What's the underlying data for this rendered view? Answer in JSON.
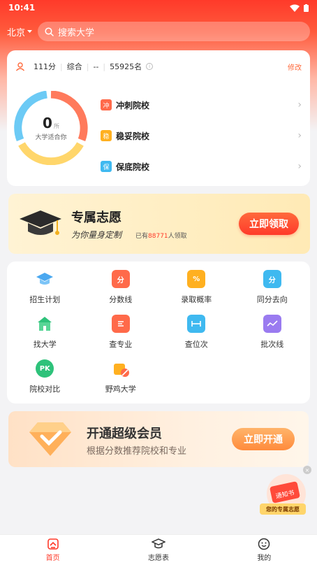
{
  "status_bar": {
    "time": "10:41"
  },
  "header": {
    "city": "北京",
    "search_placeholder": "搜索大学"
  },
  "score": {
    "points": "111分",
    "subject": "综合",
    "dash": "--",
    "rank": "55925名",
    "edit_label": "修改"
  },
  "donut": {
    "count": "0",
    "unit": "所",
    "caption": "大学适合你",
    "colors": [
      "#ff7a5c",
      "#ffd66b",
      "#6ccaf5"
    ]
  },
  "categories": [
    {
      "badge": "冲",
      "label": "冲刺院校",
      "color": "#ff6a4a"
    },
    {
      "badge": "稳",
      "label": "稳妥院校",
      "color": "#ffb020"
    },
    {
      "badge": "保",
      "label": "保底院校",
      "color": "#3fb9f0"
    }
  ],
  "exclusive_banner": {
    "title": "专属志愿",
    "slogan": "为你量身定制",
    "count_prefix": "已有",
    "count_value": "88771",
    "count_suffix": "人领取",
    "cta": "立即领取"
  },
  "tools": [
    {
      "label": "招生计划",
      "icon": "graduation-cap-icon",
      "color": "#4aa8f0"
    },
    {
      "label": "分数线",
      "icon": "score-book-icon",
      "color": "#ff6a4a"
    },
    {
      "label": "录取概率",
      "icon": "percent-icon",
      "color": "#ffb020"
    },
    {
      "label": "同分去向",
      "icon": "same-score-icon",
      "color": "#3fb9f0"
    },
    {
      "label": "找大学",
      "icon": "university-icon",
      "color": "#2ec27a"
    },
    {
      "label": "查专业",
      "icon": "major-book-icon",
      "color": "#ff6a4a"
    },
    {
      "label": "查位次",
      "icon": "rank-icon",
      "color": "#3fb9f0"
    },
    {
      "label": "批次线",
      "icon": "batch-line-icon",
      "color": "#9a7bf0"
    },
    {
      "label": "院校对比",
      "icon": "pk-icon",
      "color": "#2ec27a"
    },
    {
      "label": "野鸡大学",
      "icon": "fake-university-icon",
      "color": "#ff8b3c"
    }
  ],
  "vip_banner": {
    "title": "开通超级会员",
    "subtitle": "根据分数推荐院校和专业",
    "cta": "立即开通"
  },
  "float_ad": {
    "badge": "通知书",
    "label": "您的专属志愿"
  },
  "tabbar": [
    {
      "label": "首页",
      "active": true
    },
    {
      "label": "志愿表",
      "active": false
    },
    {
      "label": "我的",
      "active": false
    }
  ]
}
